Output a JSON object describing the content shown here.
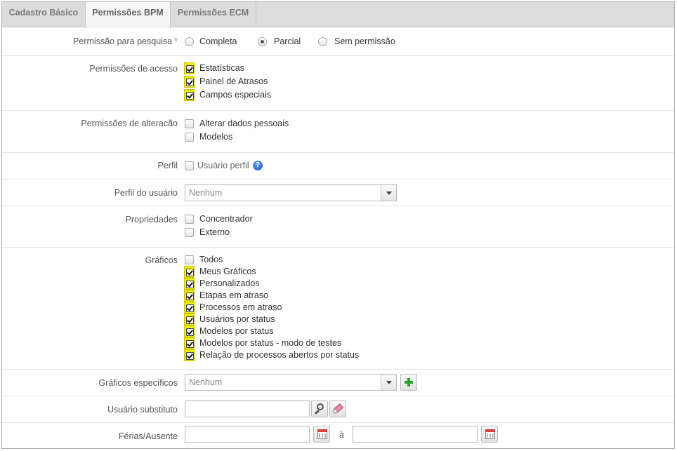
{
  "tabs": [
    {
      "label": "Cadastro Básico",
      "active": false
    },
    {
      "label": "Permissões BPM",
      "active": true
    },
    {
      "label": "Permissões ECM",
      "active": false
    }
  ],
  "colors": {
    "checked_highlight": "#f0ef00",
    "required_star": "#e27575",
    "add_green": "#2ea02e"
  },
  "search_permission": {
    "label": "Permissão para pesquisa",
    "required": "*",
    "options": [
      {
        "label": "Completa",
        "selected": false
      },
      {
        "label": "Parcial",
        "selected": true
      },
      {
        "label": "Sem permissão",
        "selected": false
      }
    ]
  },
  "access_permissions": {
    "label": "Permissões de acesso",
    "options": [
      {
        "label": "Estatísticas",
        "checked": true
      },
      {
        "label": "Painel de Atrasos",
        "checked": true
      },
      {
        "label": "Campos especiais",
        "checked": true
      }
    ]
  },
  "change_permissions": {
    "label": "Permissões de alteracão",
    "options": [
      {
        "label": "Alterar dados pessoais",
        "checked": false
      },
      {
        "label": "Modelos",
        "checked": false
      }
    ]
  },
  "profile": {
    "label": "Perfil",
    "option": "Usuário perfil",
    "checked": false,
    "help_icon": "question-icon",
    "help_glyph": "?"
  },
  "user_profile": {
    "label": "Perfil do usuário",
    "value": "Nenhum"
  },
  "properties": {
    "label": "Propriedades",
    "options": [
      {
        "label": "Concentrador",
        "checked": false
      },
      {
        "label": "Externo",
        "checked": false
      }
    ]
  },
  "charts": {
    "label": "Gráficos",
    "options": [
      {
        "label": "Todos",
        "checked": false
      },
      {
        "label": "Meus Gráficos",
        "checked": true
      },
      {
        "label": "Personalizados",
        "checked": true
      },
      {
        "label": "Etapas em atraso",
        "checked": true
      },
      {
        "label": "Processos em atraso",
        "checked": true
      },
      {
        "label": "Usuários por status",
        "checked": true
      },
      {
        "label": "Modelos por status",
        "checked": true
      },
      {
        "label": "Modelos por status - modo de testes",
        "checked": true
      },
      {
        "label": "Relação de processos abertos por status",
        "checked": true
      }
    ]
  },
  "specific_charts": {
    "label": "Gráficos específicos",
    "value": "Nenhum",
    "add_icon": "plus-icon"
  },
  "substitute_user": {
    "label": "Usuário substituto",
    "value": "",
    "search_icon": "magnifier-icon",
    "clear_icon": "eraser-icon"
  },
  "vacation": {
    "label": "Férias/Ausente",
    "from": "",
    "to": "",
    "separator": "à",
    "calendar_icon": "calendar-icon"
  }
}
